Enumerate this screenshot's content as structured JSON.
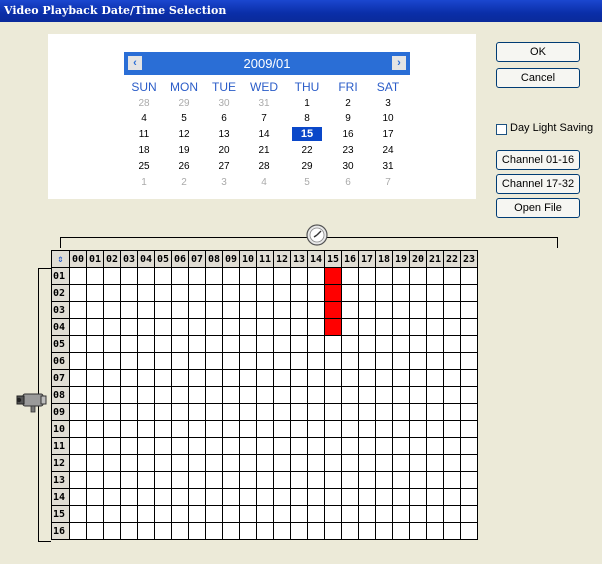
{
  "window": {
    "title": "Video Playback Date/Time Selection"
  },
  "calendar": {
    "month_label": "2009/01",
    "prev_glyph": "‹",
    "next_glyph": "›",
    "days_of_week": [
      "SUN",
      "MON",
      "TUE",
      "WED",
      "THU",
      "FRI",
      "SAT"
    ],
    "weeks": [
      [
        "28",
        "29",
        "30",
        "31",
        "1",
        "2",
        "3"
      ],
      [
        "4",
        "5",
        "6",
        "7",
        "8",
        "9",
        "10"
      ],
      [
        "11",
        "12",
        "13",
        "14",
        "15",
        "16",
        "17"
      ],
      [
        "18",
        "19",
        "20",
        "21",
        "22",
        "23",
        "24"
      ],
      [
        "25",
        "26",
        "27",
        "28",
        "29",
        "30",
        "31"
      ],
      [
        "1",
        "2",
        "3",
        "4",
        "5",
        "6",
        "7"
      ]
    ],
    "selected_day": "15",
    "accent_color": "#2a6ed6",
    "selected_color": "#0a47c9"
  },
  "buttons": {
    "ok": "OK",
    "cancel": "Cancel",
    "channel_1_16": "Channel 01-16",
    "channel_17_32": "Channel 17-32",
    "open_file": "Open File"
  },
  "daylight": {
    "label": "Day Light Saving",
    "checked": false
  },
  "grid": {
    "sort_glyph": "⇕",
    "hours": [
      "00",
      "01",
      "02",
      "03",
      "04",
      "05",
      "06",
      "07",
      "08",
      "09",
      "10",
      "11",
      "12",
      "13",
      "14",
      "15",
      "16",
      "17",
      "18",
      "19",
      "20",
      "21",
      "22",
      "23"
    ],
    "channels": [
      "01",
      "02",
      "03",
      "04",
      "05",
      "06",
      "07",
      "08",
      "09",
      "10",
      "11",
      "12",
      "13",
      "14",
      "15",
      "16"
    ],
    "recordings": [
      {
        "channel": "01",
        "hour": "15"
      },
      {
        "channel": "02",
        "hour": "15"
      },
      {
        "channel": "03",
        "hour": "15"
      },
      {
        "channel": "04",
        "hour": "15"
      }
    ],
    "record_color": "#ff0000"
  },
  "icons": {
    "clock": "clock-icon",
    "camera": "camera-icon"
  }
}
